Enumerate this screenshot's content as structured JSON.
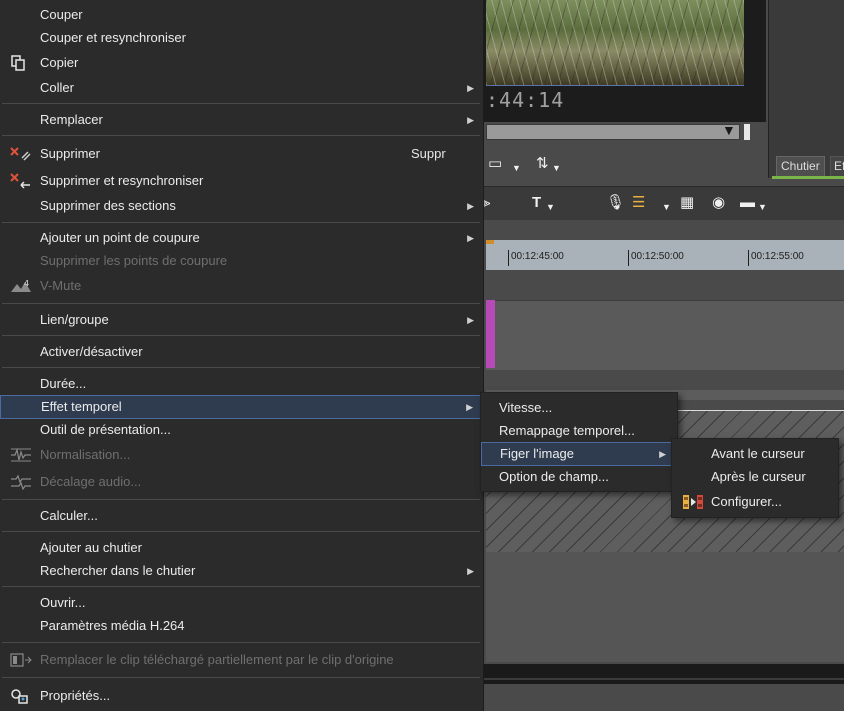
{
  "app": {
    "timecode": ":44:14",
    "panel_tabs": [
      "Chutier",
      "Ef"
    ],
    "ruler_labels": [
      "00:12:45:00",
      "00:12:50:00",
      "00:12:55:00"
    ]
  },
  "main_menu": {
    "items": [
      {
        "label": "Couper",
        "icon": "",
        "disabled": false,
        "submenu": false
      },
      {
        "label": "Couper et resynchroniser",
        "icon": "",
        "disabled": false,
        "submenu": false
      },
      {
        "label": "Copier",
        "icon": "copy-icon",
        "disabled": false,
        "submenu": false
      },
      {
        "label": "Coller",
        "icon": "",
        "disabled": false,
        "submenu": true
      },
      {
        "label": "Remplacer",
        "icon": "",
        "disabled": false,
        "submenu": true
      },
      {
        "label": "Supprimer",
        "icon": "delete-icon",
        "disabled": false,
        "submenu": false,
        "shortcut": "Suppr"
      },
      {
        "label": "Supprimer et resynchroniser",
        "icon": "delete-ripple-icon",
        "disabled": false,
        "submenu": false
      },
      {
        "label": "Supprimer des sections",
        "icon": "",
        "disabled": false,
        "submenu": true
      },
      {
        "label": "Ajouter un point de coupure",
        "icon": "",
        "disabled": false,
        "submenu": true
      },
      {
        "label": "Supprimer les points de coupure",
        "icon": "",
        "disabled": true,
        "submenu": false
      },
      {
        "label": "V-Mute",
        "icon": "v-mute-icon",
        "disabled": true,
        "submenu": false
      },
      {
        "label": "Lien/groupe",
        "icon": "",
        "disabled": false,
        "submenu": true
      },
      {
        "label": "Activer/désactiver",
        "icon": "",
        "disabled": false,
        "submenu": false
      },
      {
        "label": "Durée...",
        "icon": "",
        "disabled": false,
        "submenu": false
      },
      {
        "label": "Effet temporel",
        "icon": "",
        "disabled": false,
        "submenu": true,
        "highlighted": true
      },
      {
        "label": "Outil de présentation...",
        "icon": "",
        "disabled": false,
        "submenu": false
      },
      {
        "label": "Normalisation...",
        "icon": "normalize-icon",
        "disabled": true,
        "submenu": false
      },
      {
        "label": "Décalage audio...",
        "icon": "audio-offset-icon",
        "disabled": true,
        "submenu": false
      },
      {
        "label": "Calculer...",
        "icon": "",
        "disabled": false,
        "submenu": false
      },
      {
        "label": "Ajouter au chutier",
        "icon": "",
        "disabled": false,
        "submenu": false
      },
      {
        "label": "Rechercher dans le chutier",
        "icon": "",
        "disabled": false,
        "submenu": true
      },
      {
        "label": "Ouvrir...",
        "icon": "",
        "disabled": false,
        "submenu": false
      },
      {
        "label": "Paramètres média H.264",
        "icon": "",
        "disabled": false,
        "submenu": false
      },
      {
        "label": "Remplacer le clip téléchargé partiellement par le clip d'origine",
        "icon": "replace-clip-icon",
        "disabled": true,
        "submenu": false
      },
      {
        "label": "Propriétés...",
        "icon": "properties-icon",
        "disabled": false,
        "submenu": false
      }
    ]
  },
  "time_effect_menu": {
    "items": [
      {
        "label": "Vitesse...",
        "submenu": false
      },
      {
        "label": "Remappage temporel...",
        "submenu": false
      },
      {
        "label": "Figer l'image",
        "submenu": true,
        "highlighted": true
      },
      {
        "label": "Option de champ...",
        "submenu": false
      }
    ]
  },
  "freeze_menu": {
    "items": [
      {
        "label": "Avant le curseur",
        "icon": ""
      },
      {
        "label": "Après le curseur",
        "icon": ""
      },
      {
        "label": "Configurer...",
        "icon": "configure-icon"
      }
    ]
  },
  "colors": {
    "menu_bg": "#2b2b2b",
    "highlight_border": "#4a6aa0",
    "clip_accent": "#b64bb8",
    "panel_accent": "#7bb54a"
  }
}
